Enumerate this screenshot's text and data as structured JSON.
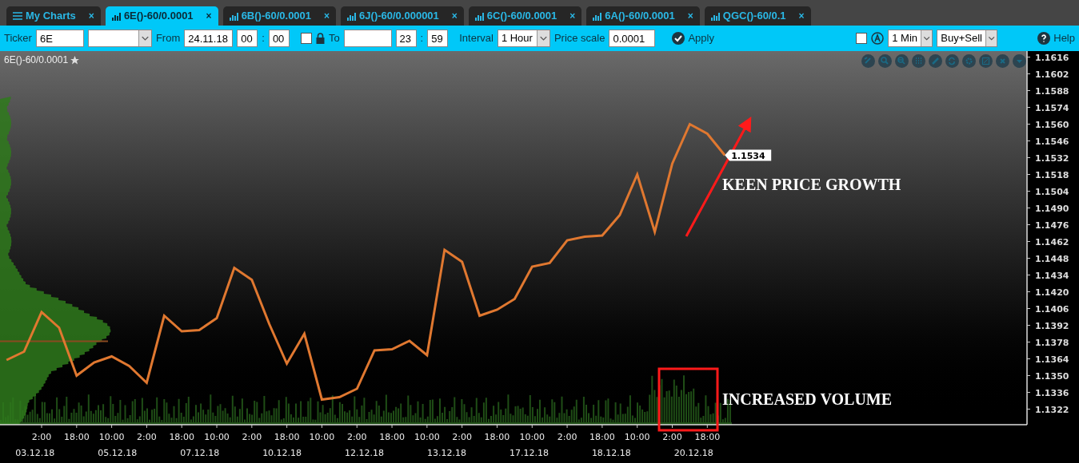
{
  "tabs": [
    {
      "label": "My Charts",
      "kind": "menu",
      "selected": false,
      "close": "×"
    },
    {
      "label": "6E()-60/0.0001",
      "kind": "chart",
      "selected": true,
      "close": "×"
    },
    {
      "label": "6B()-60/0.0001",
      "kind": "chart",
      "selected": false,
      "close": "×"
    },
    {
      "label": "6J()-60/0.000001",
      "kind": "chart",
      "selected": false,
      "close": "×"
    },
    {
      "label": "6C()-60/0.0001",
      "kind": "chart",
      "selected": false,
      "close": "×"
    },
    {
      "label": "6A()-60/0.0001",
      "kind": "chart",
      "selected": false,
      "close": "×"
    },
    {
      "label": "QGC()-60/0.1",
      "kind": "chart",
      "selected": false,
      "close": "×"
    }
  ],
  "toolbar": {
    "ticker": {
      "label": "Ticker",
      "value": "6E"
    },
    "from": {
      "label": "From",
      "date": "24.11.18",
      "hour": "00",
      "separator": ":",
      "minute": "00"
    },
    "lock": {
      "checked": false
    },
    "to": {
      "label": "To",
      "hour": "23",
      "separator": ":",
      "minute": "59"
    },
    "interval": {
      "label": "Interval",
      "value": "1 Hour"
    },
    "price_scale": {
      "label": "Price scale",
      "value": "0.0001"
    },
    "apply": "Apply",
    "auto": {
      "checked": false
    },
    "period": "1 Min",
    "side": "Buy+Sell",
    "help": "Help"
  },
  "chart": {
    "title": "6E()-60/0.0001",
    "dates": [
      "03.12.18",
      "05.12.18",
      "07.12.18",
      "10.12.18",
      "12.12.18",
      "13.12.18",
      "17.12.18",
      "18.12.18",
      "20.12.18"
    ],
    "chart_data": {
      "type": "line",
      "ylim": [
        1.1309,
        1.1621
      ],
      "categories": [
        null,
        null,
        "2:00",
        null,
        "18:00",
        null,
        "10:00",
        null,
        "2:00",
        null,
        "18:00",
        null,
        "10:00",
        null,
        "2:00",
        null,
        "18:00",
        null,
        "10:00",
        null,
        "2:00",
        null,
        "18:00",
        null,
        "10:00",
        null,
        "2:00",
        null,
        "18:00",
        null,
        "10:00",
        null,
        "2:00",
        null,
        "18:00",
        null,
        "10:00",
        null,
        "2:00",
        null,
        "18:00",
        null
      ],
      "series": [
        {
          "color": "#e07830",
          "values": [
            1.1363,
            1.137,
            1.1403,
            1.139,
            1.135,
            1.1361,
            1.1366,
            1.1358,
            1.1344,
            1.14,
            1.1387,
            1.1388,
            1.1398,
            1.144,
            1.143,
            1.1393,
            1.136,
            1.1385,
            1.133,
            1.1332,
            1.1339,
            1.1371,
            1.1372,
            1.1379,
            1.1367,
            1.1455,
            1.1445,
            1.14,
            1.1405,
            1.1414,
            1.1441,
            1.1444,
            1.1463,
            1.1466,
            1.1467,
            1.1484,
            1.1518,
            1.147,
            1.1527,
            1.156,
            1.1552,
            1.1534
          ]
        }
      ],
      "yticks": [
        {
          "value": 1.1616,
          "label": "1.1616"
        },
        {
          "value": 1.1602,
          "label": "1.1602"
        },
        {
          "value": 1.1588,
          "label": "1.1588"
        },
        {
          "value": 1.1574,
          "label": "1.1574"
        },
        {
          "value": 1.156,
          "label": "1.1560"
        },
        {
          "value": 1.1546,
          "label": "1.1546"
        },
        {
          "value": 1.1532,
          "label": "1.1532"
        },
        {
          "value": 1.1518,
          "label": "1.1518"
        },
        {
          "value": 1.1504,
          "label": "1.1504"
        },
        {
          "value": 1.149,
          "label": "1.1490"
        },
        {
          "value": 1.1476,
          "label": "1.1476"
        },
        {
          "value": 1.1462,
          "label": "1.1462"
        },
        {
          "value": 1.1448,
          "label": "1.1448"
        },
        {
          "value": 1.1434,
          "label": "1.1434"
        },
        {
          "value": 1.142,
          "label": "1.1420"
        },
        {
          "value": 1.1406,
          "label": "1.1406"
        },
        {
          "value": 1.1392,
          "label": "1.1392"
        },
        {
          "value": 1.1378,
          "label": "1.1378"
        },
        {
          "value": 1.1364,
          "label": "1.1364"
        },
        {
          "value": 1.135,
          "label": "1.1350"
        },
        {
          "value": 1.1336,
          "label": "1.1336"
        },
        {
          "value": 1.1322,
          "label": "1.1322"
        }
      ],
      "annotations": [
        "1.1534",
        "KEEN PRICE GROWTH",
        "INCREASED VOLUME"
      ]
    }
  }
}
